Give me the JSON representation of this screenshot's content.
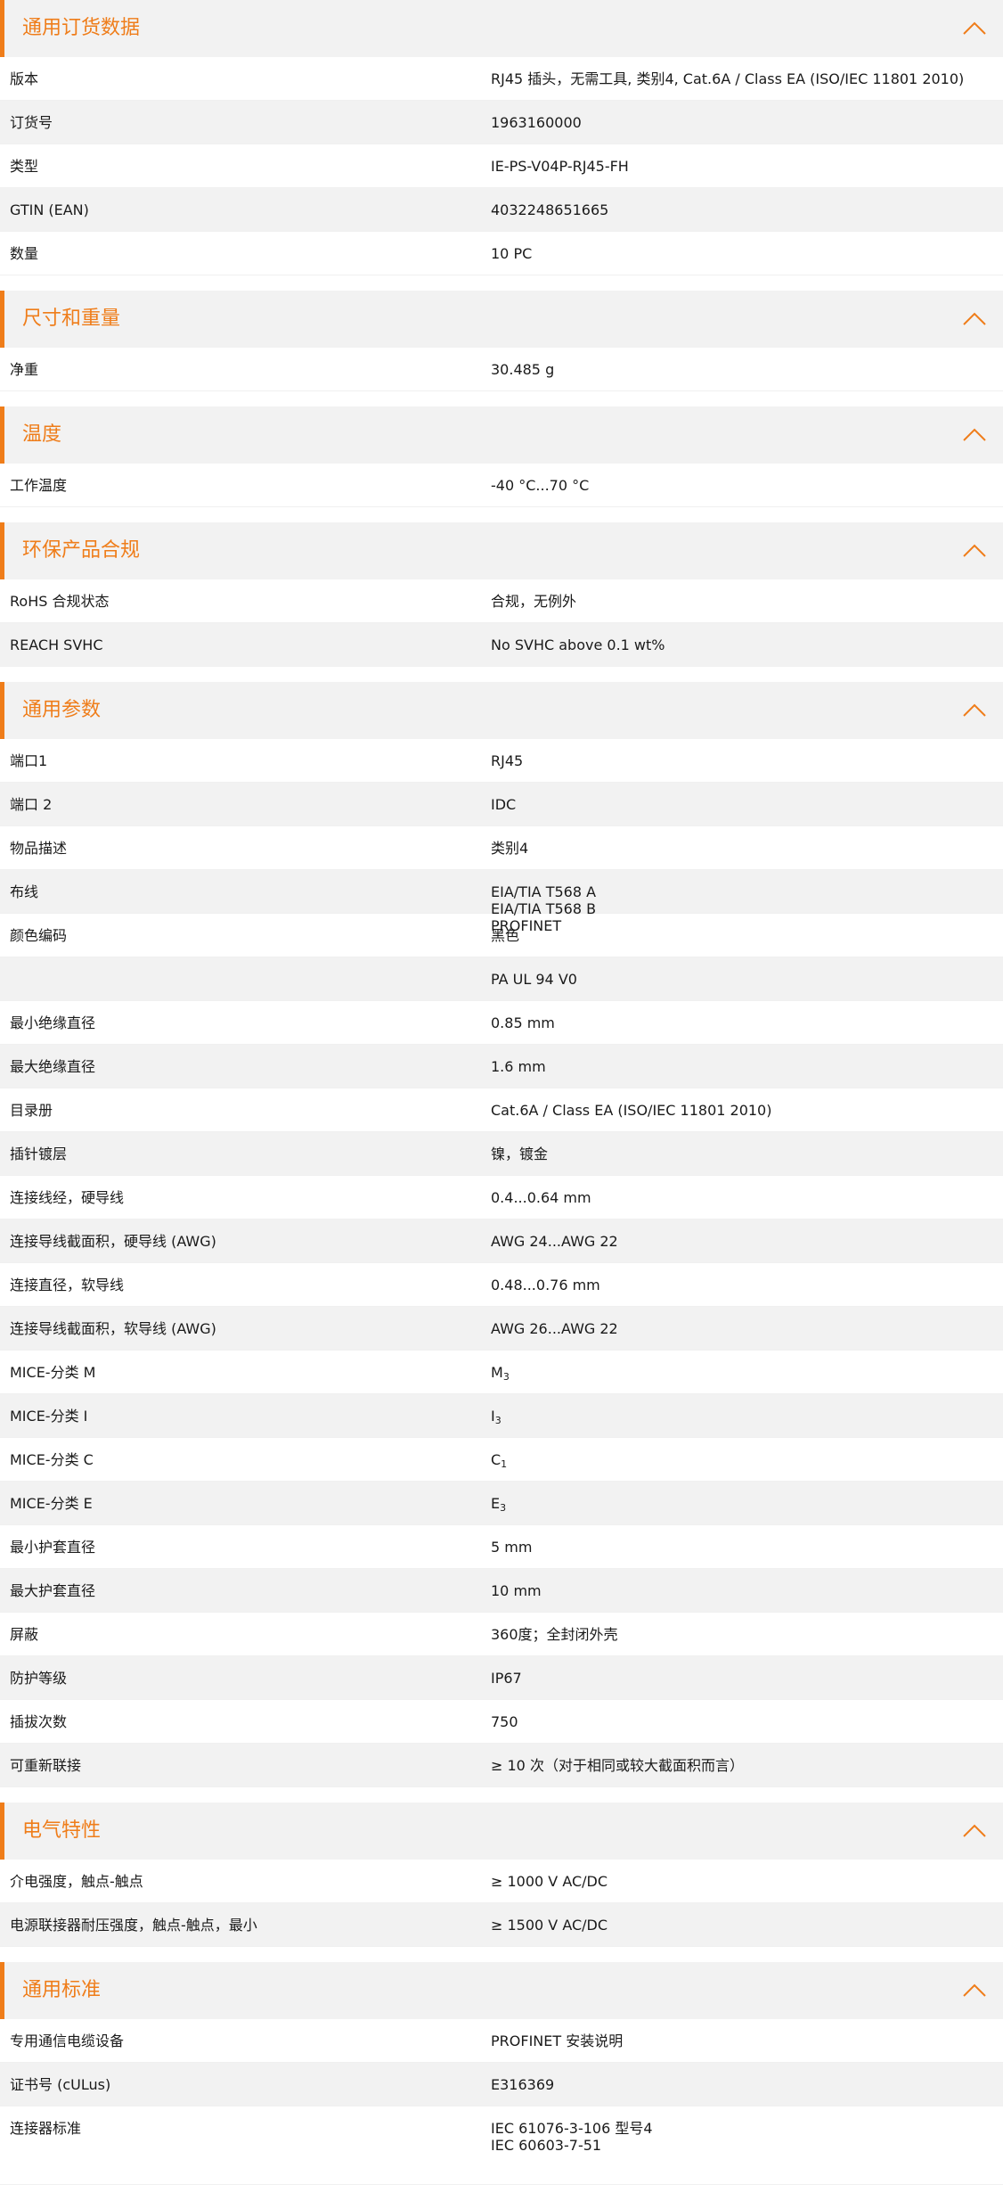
{
  "accent_color": "#ef7d1a",
  "sections": [
    {
      "title": "通用订货数据",
      "icon": "chevron-up-icon",
      "rows": [
        {
          "label": "版本",
          "value": "RJ45 插头，无需工具, 类别4, Cat.6A / Class EA (ISO/IEC 11801 2010)"
        },
        {
          "label": "订货号",
          "value": "1963160000"
        },
        {
          "label": "类型",
          "value": "IE-PS-V04P-RJ45-FH"
        },
        {
          "label": "GTIN (EAN)",
          "value": "4032248651665"
        },
        {
          "label": "数量",
          "value": "10  PC"
        }
      ]
    },
    {
      "title": "尺寸和重量",
      "icon": "chevron-up-icon",
      "rows": [
        {
          "label": "净重",
          "value": "30.485  g"
        }
      ]
    },
    {
      "title": "温度",
      "icon": "chevron-up-icon",
      "rows": [
        {
          "label": "工作温度",
          "value": "-40 °C...70 °C"
        }
      ]
    },
    {
      "title": "环保产品合规",
      "icon": "chevron-up-icon",
      "rows": [
        {
          "label": "RoHS 合规状态",
          "value": "合规，无例外"
        },
        {
          "label": "REACH SVHC",
          "value": "No SVHC above 0.1 wt%"
        }
      ]
    },
    {
      "title": "通用参数",
      "icon": "chevron-up-icon",
      "rows": [
        {
          "label": "端口1",
          "value": "RJ45"
        },
        {
          "label": "端口 2",
          "value": "IDC"
        },
        {
          "label": "物品描述",
          "value": "类别4"
        },
        {
          "label": "布线",
          "value": "EIA/TIA T568 A\nEIA/TIA T568 B\nPROFINET"
        },
        {
          "label": "颜色编码",
          "value": "黑色"
        },
        {
          "label": "",
          "value": "PA UL 94 V0"
        },
        {
          "label": "最小绝缘直径",
          "value": "0.85  mm"
        },
        {
          "label": "最大绝缘直径",
          "value": "1.6  mm"
        },
        {
          "label": "目录册",
          "value": "Cat.6A / Class EA (ISO/IEC 11801 2010)"
        },
        {
          "label": "插针镀层",
          "value": "镍，镀金"
        },
        {
          "label": "连接线经，硬导线",
          "value": "0.4...0.64 mm"
        },
        {
          "label": "连接导线截面积，硬导线 (AWG)",
          "value": "AWG 24...AWG 22"
        },
        {
          "label": "连接直径，软导线",
          "value": "0.48...0.76 mm"
        },
        {
          "label": "连接导线截面积，软导线 (AWG)",
          "value": "AWG 26...AWG 22"
        },
        {
          "label": "MICE-分类 M",
          "value": "M",
          "sub": "3"
        },
        {
          "label": "MICE-分类 I",
          "value": "I",
          "sub": "3"
        },
        {
          "label": "MICE-分类 C",
          "value": "C",
          "sub": "1"
        },
        {
          "label": "MICE-分类 E",
          "value": "E",
          "sub": "3"
        },
        {
          "label": "最小护套直径",
          "value": "5  mm"
        },
        {
          "label": "最大护套直径",
          "value": "10  mm"
        },
        {
          "label": "屏蔽",
          "value": "360度；全封闭外壳"
        },
        {
          "label": "防护等级",
          "value": "IP67"
        },
        {
          "label": "插拔次数",
          "value": "750"
        },
        {
          "label": "可重新联接",
          "value": "≥ 10 次（对于相同或较大截面积而言）"
        }
      ]
    },
    {
      "title": "电气特性",
      "icon": "chevron-up-icon",
      "rows": [
        {
          "label": "介电强度，触点-触点",
          "value": "≥ 1000 V AC/DC"
        },
        {
          "label": "电源联接器耐压强度，触点-触点，最小",
          "value": "≥ 1500 V AC/DC"
        }
      ]
    },
    {
      "title": "通用标准",
      "icon": "chevron-up-icon",
      "rows": [
        {
          "label": "专用通信电缆设备",
          "value": "PROFINET 安装说明"
        },
        {
          "label": "证书号 (cULus)",
          "value": "E316369"
        },
        {
          "label": "连接器标准",
          "value": "IEC 61076-3-106 型号4\nIEC 60603-7-51"
        }
      ]
    }
  ]
}
